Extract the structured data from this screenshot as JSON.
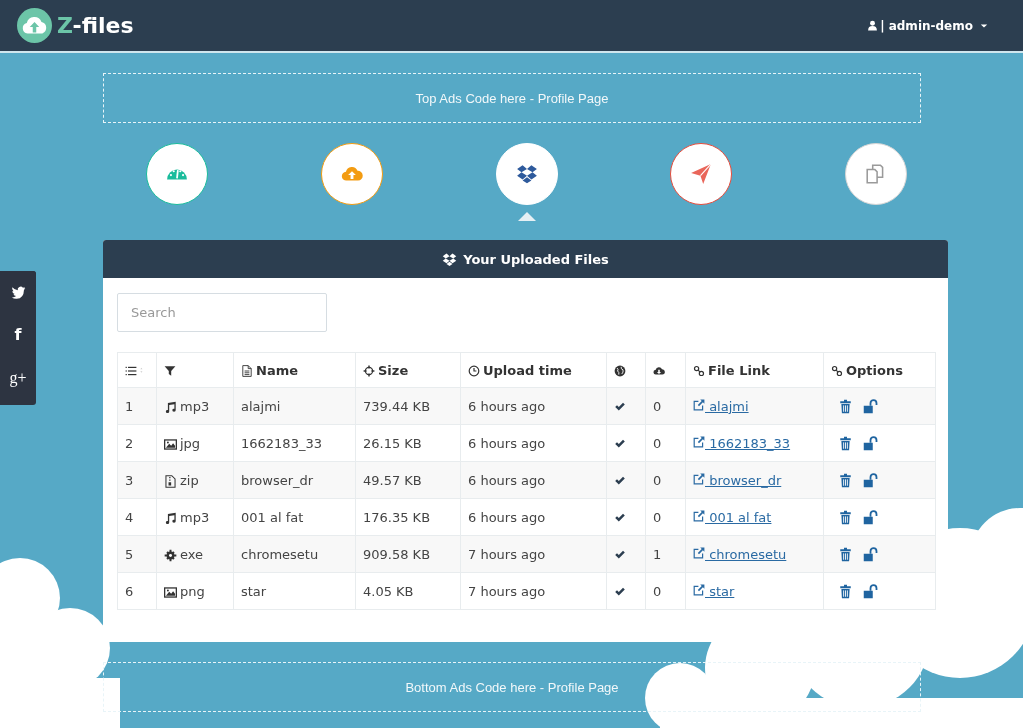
{
  "navbar": {
    "brand_accent": "Z",
    "brand_rest": "-files",
    "user": "| admin-demo"
  },
  "top_ad": "Top Ads Code here - Profile Page",
  "social": [
    {
      "kind": "twitter"
    },
    {
      "kind": "facebook",
      "glyph": "f"
    },
    {
      "kind": "googleplus",
      "glyph": "g+"
    }
  ],
  "nav": [
    {
      "kind": "dashboard",
      "color": "#1abc9c",
      "selected": false
    },
    {
      "kind": "upload",
      "color": "#f39c12",
      "selected": false
    },
    {
      "kind": "files",
      "color": "#ffffff",
      "selected": true
    },
    {
      "kind": "send",
      "color": "#e74c3c",
      "selected": false
    },
    {
      "kind": "copy",
      "color": "#d5d5d5",
      "selected": false
    }
  ],
  "panel": {
    "title": "Your Uploaded Files",
    "search": {
      "placeholder": "Search"
    },
    "table": {
      "columns": [
        {
          "kind": "index"
        },
        {
          "kind": "type"
        },
        {
          "kind": "name",
          "label": "Name"
        },
        {
          "kind": "size",
          "label": "Size"
        },
        {
          "kind": "time",
          "label": "Upload time"
        },
        {
          "kind": "public"
        },
        {
          "kind": "downloads"
        },
        {
          "kind": "link",
          "label": "File Link"
        },
        {
          "kind": "options",
          "label": "Options"
        }
      ],
      "rows": [
        {
          "index": "1",
          "kind": "audio",
          "type": "mp3",
          "name": "alajmi",
          "size": "739.44 KB",
          "uploaded": "6 hours ago",
          "public": true,
          "downloads": "0",
          "link": "alajmi"
        },
        {
          "index": "2",
          "kind": "image",
          "type": "jpg",
          "name": "1662183_33",
          "size": "26.15 KB",
          "uploaded": "6 hours ago",
          "public": true,
          "downloads": "0",
          "link": "1662183_33"
        },
        {
          "index": "3",
          "kind": "archive",
          "type": "zip",
          "name": "browser_dr",
          "size": "49.57 KB",
          "uploaded": "6 hours ago",
          "public": true,
          "downloads": "0",
          "link": "browser_dr"
        },
        {
          "index": "4",
          "kind": "audio",
          "type": "mp3",
          "name": "001 al fat",
          "size": "176.35 KB",
          "uploaded": "6 hours ago",
          "public": true,
          "downloads": "0",
          "link": "001 al fat"
        },
        {
          "index": "5",
          "kind": "program",
          "type": "exe",
          "name": "chromesetu",
          "size": "909.58 KB",
          "uploaded": "7 hours ago",
          "public": true,
          "downloads": "1",
          "link": "chromesetu"
        },
        {
          "index": "6",
          "kind": "image",
          "type": "png",
          "name": "star",
          "size": "4.05 KB",
          "uploaded": "7 hours ago",
          "public": true,
          "downloads": "0",
          "link": "star"
        }
      ]
    }
  },
  "bottom_ad": "Bottom Ads Code here - Profile Page"
}
